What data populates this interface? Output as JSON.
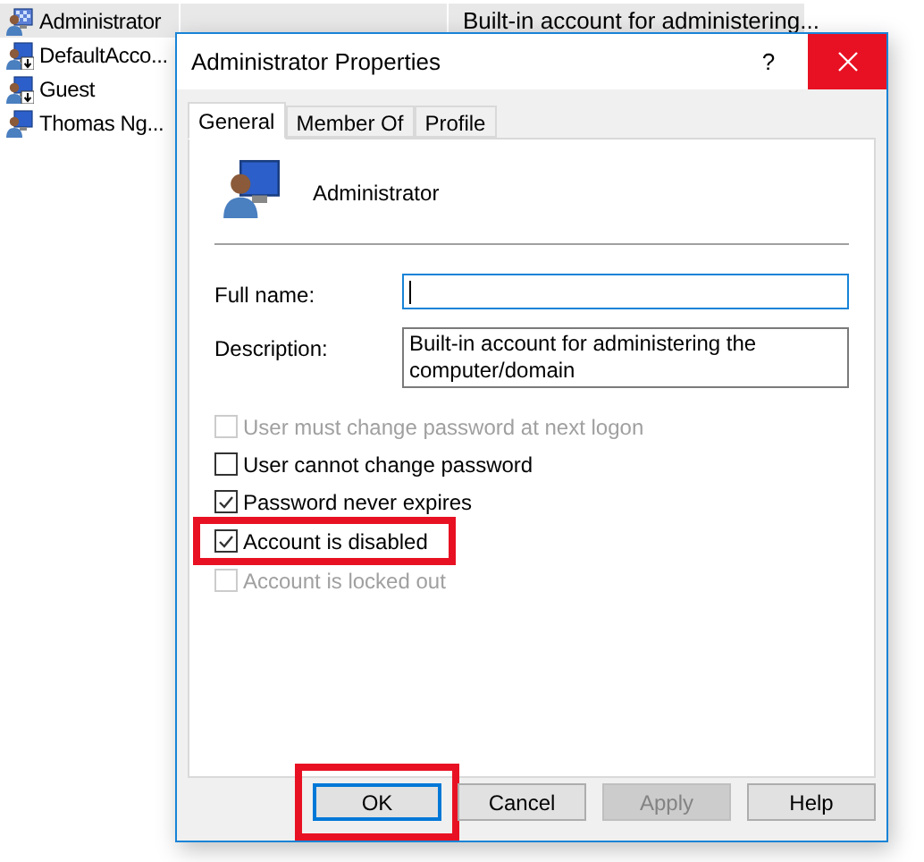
{
  "users": [
    {
      "name": "Administrator",
      "description": "Built-in account for administering...",
      "selected": true,
      "kind": "admin"
    },
    {
      "name": "DefaultAcco...",
      "selected": false,
      "kind": "standard"
    },
    {
      "name": "Guest",
      "selected": false,
      "kind": "standard"
    },
    {
      "name": "Thomas Ng...",
      "selected": false,
      "kind": "user"
    }
  ],
  "dialog": {
    "title": "Administrator Properties",
    "help": "?",
    "tabs": [
      {
        "label": "General",
        "selected": true
      },
      {
        "label": "Member Of",
        "selected": false
      },
      {
        "label": "Profile",
        "selected": false
      }
    ],
    "account_name": "Administrator",
    "fields": [
      {
        "label": "Full name:",
        "focused": true,
        "multiline": false
      },
      {
        "label": "Description:",
        "value": "Built-in account for administering the computer/domain",
        "focused": false,
        "multiline": true
      }
    ],
    "options": [
      {
        "label": "User must change password at next logon",
        "checked": false,
        "disabled": true,
        "highlighted": false
      },
      {
        "label": "User cannot change password",
        "checked": false,
        "disabled": false,
        "highlighted": false
      },
      {
        "label": "Password never expires",
        "checked": true,
        "disabled": false,
        "highlighted": false
      },
      {
        "label": "Account is disabled",
        "checked": true,
        "disabled": false,
        "highlighted": true
      },
      {
        "label": "Account is locked out",
        "checked": false,
        "disabled": true,
        "highlighted": false
      }
    ],
    "buttons": [
      {
        "label": "OK",
        "default": true,
        "disabled": false,
        "highlighted": true
      },
      {
        "label": "Cancel",
        "default": false,
        "disabled": false,
        "highlighted": false
      },
      {
        "label": "Apply",
        "default": false,
        "disabled": true,
        "highlighted": false
      },
      {
        "label": "Help",
        "default": false,
        "disabled": false,
        "highlighted": false
      }
    ]
  }
}
